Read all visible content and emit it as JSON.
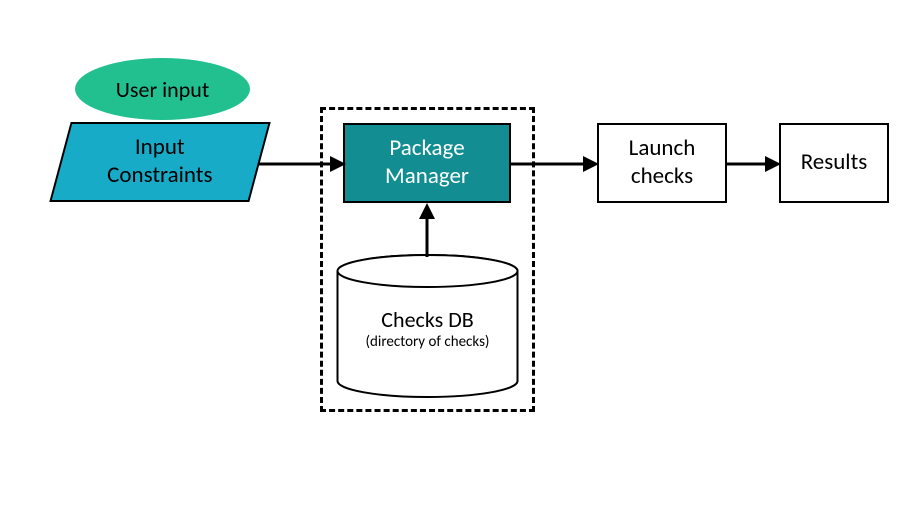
{
  "nodes": {
    "user_input": {
      "label": "User input",
      "fill": "#22c08f",
      "text_color": "#000000"
    },
    "input_constraints": {
      "label": "Input\nConstraints",
      "fill": "#17abc7",
      "text_color": "#000000"
    },
    "package_manager": {
      "label": "Package\nManager",
      "fill": "#128e92",
      "text_color": "#ffffff"
    },
    "launch_checks": {
      "label": "Launch\nchecks",
      "fill": "#ffffff",
      "stroke": "#000000",
      "text_color": "#000000"
    },
    "results": {
      "label": "Results",
      "fill": "#ffffff",
      "stroke": "#000000",
      "text_color": "#000000"
    },
    "checks_db": {
      "title": "Checks DB",
      "subtitle": "(directory of checks)",
      "fill": "#ffffff",
      "stroke": "#000000",
      "text_color": "#000000"
    }
  },
  "edges": [
    {
      "from": "input_constraints",
      "to": "package_manager"
    },
    {
      "from": "package_manager",
      "to": "launch_checks"
    },
    {
      "from": "launch_checks",
      "to": "results"
    },
    {
      "from": "checks_db",
      "to": "package_manager"
    }
  ]
}
